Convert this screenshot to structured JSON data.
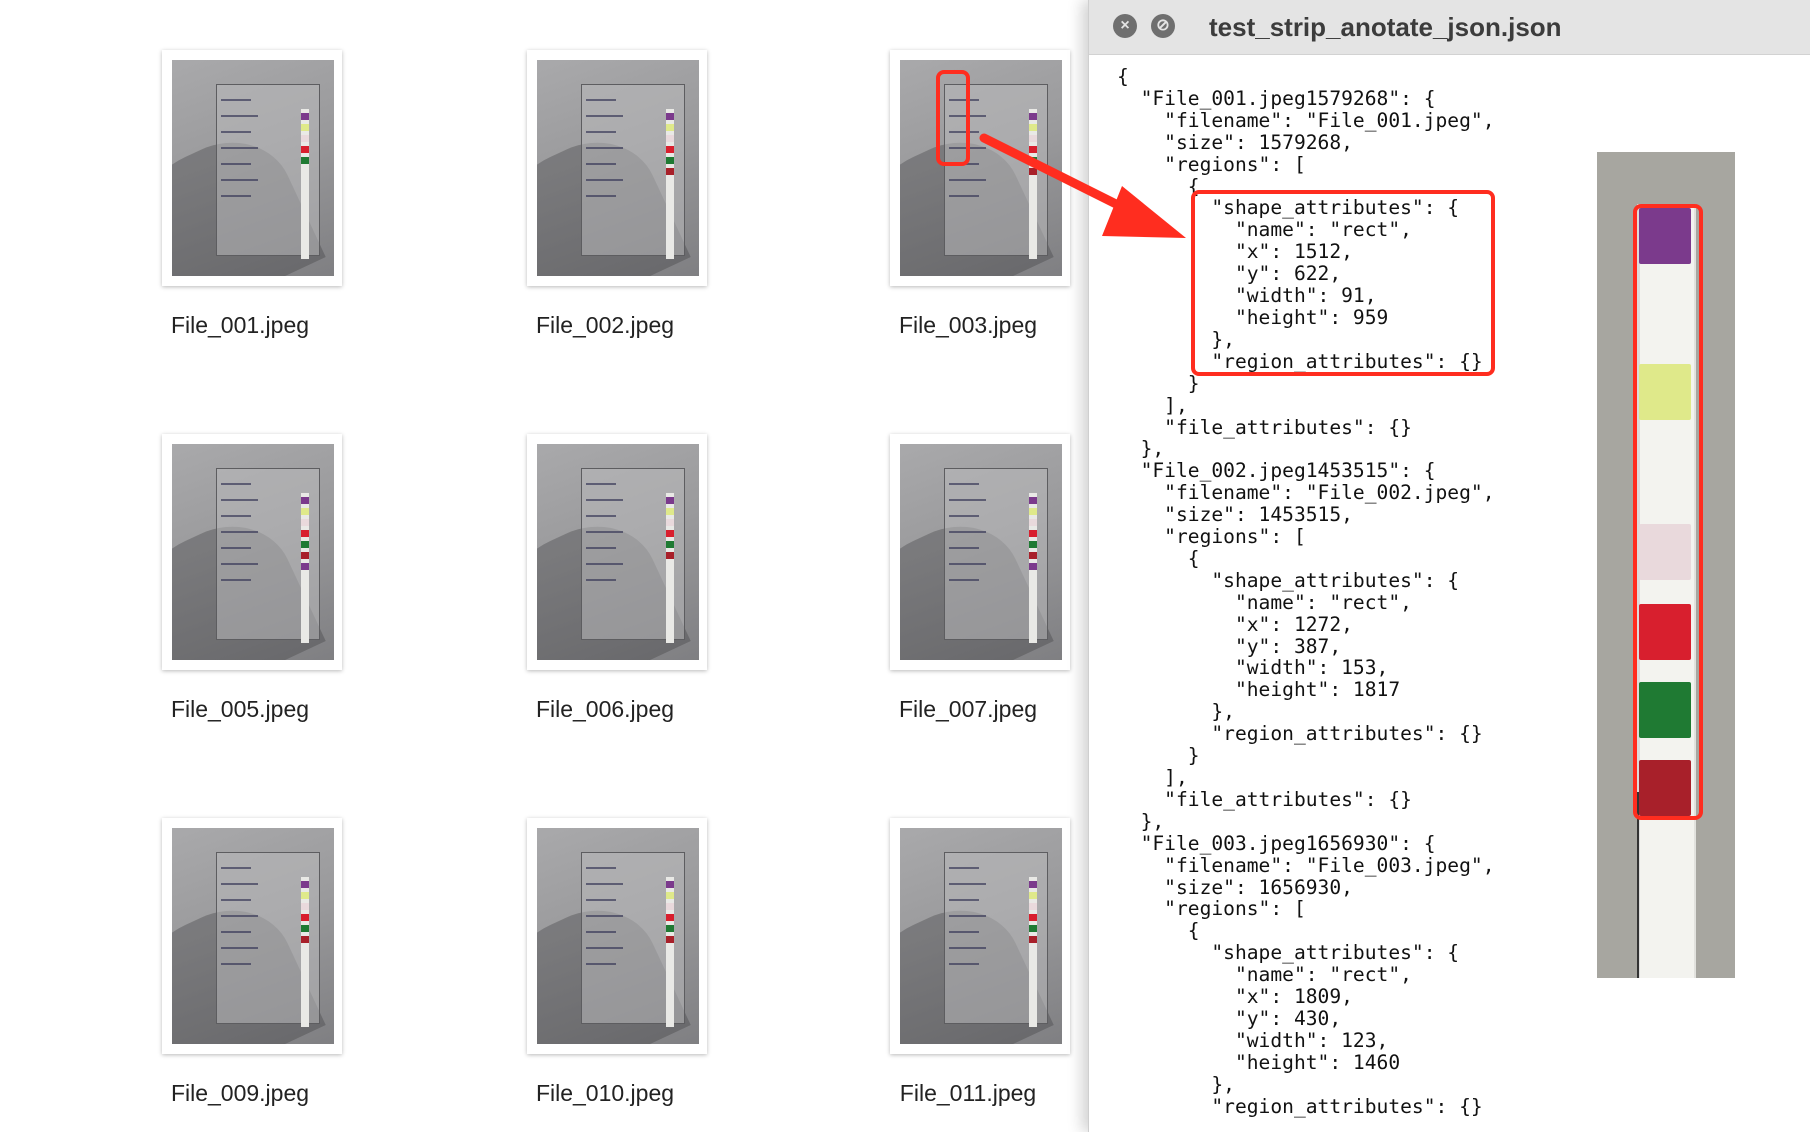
{
  "files": [
    {
      "name": "File_001.jpeg"
    },
    {
      "name": "File_002.jpeg"
    },
    {
      "name": "File_003.jpeg"
    },
    {
      "name": "File_005.jpeg"
    },
    {
      "name": "File_006.jpeg"
    },
    {
      "name": "File_007.jpeg"
    },
    {
      "name": "File_009.jpeg"
    },
    {
      "name": "File_010.jpeg"
    },
    {
      "name": "File_011.jpeg"
    }
  ],
  "window": {
    "title": "test_strip_anotate_json.json",
    "close_icon": "close-icon",
    "minimize_icon": "prohibit-icon"
  },
  "json_lines": [
    "{",
    "  \"File_001.jpeg1579268\": {",
    "    \"filename\": \"File_001.jpeg\",",
    "    \"size\": 1579268,",
    "    \"regions\": [",
    "      {",
    "        \"shape_attributes\": {",
    "          \"name\": \"rect\",",
    "          \"x\": 1512,",
    "          \"y\": 622,",
    "          \"width\": 91,",
    "          \"height\": 959",
    "        },",
    "        \"region_attributes\": {}",
    "      }",
    "    ],",
    "    \"file_attributes\": {}",
    "  },",
    "  \"File_002.jpeg1453515\": {",
    "    \"filename\": \"File_002.jpeg\",",
    "    \"size\": 1453515,",
    "    \"regions\": [",
    "      {",
    "        \"shape_attributes\": {",
    "          \"name\": \"rect\",",
    "          \"x\": 1272,",
    "          \"y\": 387,",
    "          \"width\": 153,",
    "          \"height\": 1817",
    "        },",
    "        \"region_attributes\": {}",
    "      }",
    "    ],",
    "    \"file_attributes\": {}",
    "  },",
    "  \"File_003.jpeg1656930\": {",
    "    \"filename\": \"File_003.jpeg\",",
    "    \"size\": 1656930,",
    "    \"regions\": [",
    "      {",
    "        \"shape_attributes\": {",
    "          \"name\": \"rect\",",
    "          \"x\": 1809,",
    "          \"y\": 430,",
    "          \"width\": 123,",
    "          \"height\": 1460",
    "        },",
    "        \"region_attributes\": {}"
  ],
  "colors": {
    "annotation_red": "#ff2d1f",
    "pad_colors": [
      "#7b3a8c",
      "#dfe98a",
      "#e9d9dc",
      "#d81f2e",
      "#1f7a33",
      "#a8202a"
    ]
  }
}
